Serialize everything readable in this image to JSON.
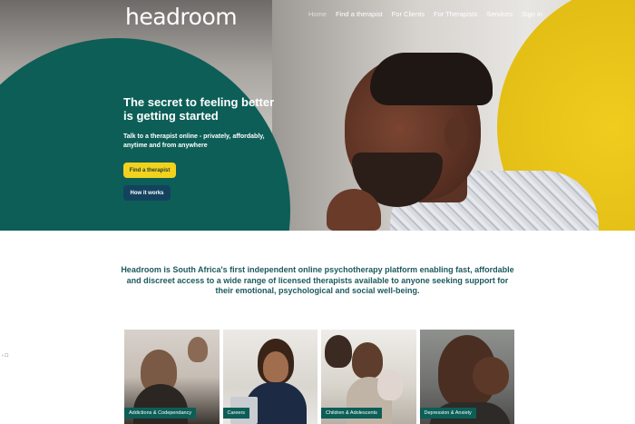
{
  "header": {
    "logo": "headroom",
    "nav": [
      "Home",
      "Find a therapist",
      "For Clients",
      "For Therapists",
      "Services",
      "Sign in"
    ]
  },
  "hero": {
    "title": "The secret to feeling better is getting started",
    "subtitle": "Talk to a therapist online - privately, affordably, anytime and from anywhere",
    "primary_cta": "Find a therapist",
    "secondary_cta": "How it works"
  },
  "intro": {
    "text": "Headroom is South Africa's first independent online psychotherapy platform enabling fast, affordable and discreet access to a wide range of licensed therapists available to anyone seeking support for their emotional, psychological and social well-being."
  },
  "side_marker": "‹ ☐",
  "categories": [
    "Addictions & Codependancy",
    "Careers",
    "Children & Adolescents",
    "Depression & Anxiety"
  ],
  "colors": {
    "brand_green": "#0c5e57",
    "brand_yellow": "#f2d21c",
    "brand_navy": "#13425e",
    "intro_text": "#1d5a5e"
  }
}
